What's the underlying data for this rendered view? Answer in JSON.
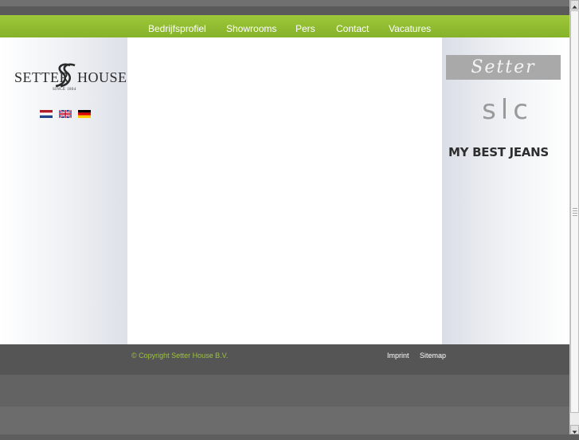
{
  "navigation": {
    "items": [
      "Bedrijfsprofiel",
      "Showrooms",
      "Pers",
      "Contact",
      "Vacatures"
    ]
  },
  "logo": {
    "left_text": "SETTER",
    "right_text": "HOUSE",
    "tagline": "SINCE 1804"
  },
  "languages": [
    {
      "name": "Dutch",
      "icon": "dutch-flag-icon"
    },
    {
      "name": "English",
      "icon": "uk-flag-icon"
    },
    {
      "name": "German",
      "icon": "german-flag-icon"
    }
  ],
  "brands": {
    "setter": "Setter",
    "slc": "slc",
    "my_best_jeans": "MY BEST JEANS"
  },
  "footer": {
    "copyright": "© Copyright Setter House B.V.",
    "links": [
      "Imprint",
      "Sitemap"
    ]
  },
  "colors": {
    "nav_green": "#9dc83a",
    "copyright_green": "#9bc43a",
    "footer_gray": "#555555"
  }
}
